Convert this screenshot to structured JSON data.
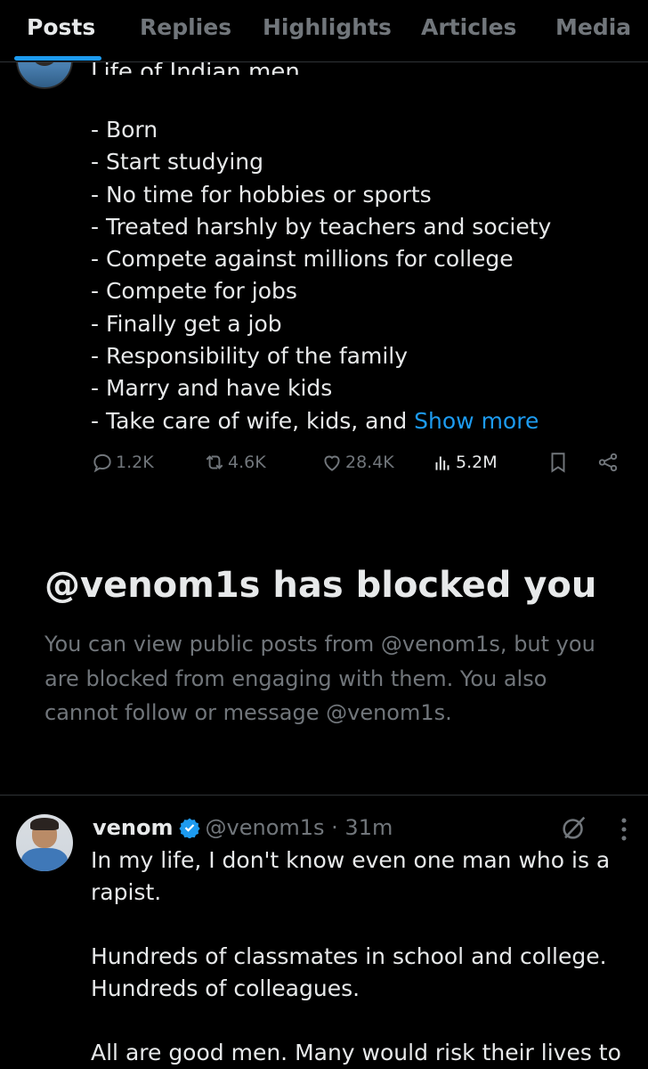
{
  "tabs": [
    {
      "label": "Posts",
      "active": true
    },
    {
      "label": "Replies",
      "active": false
    },
    {
      "label": "Highlights",
      "active": false
    },
    {
      "label": "Articles",
      "active": false
    },
    {
      "label": "Media",
      "active": false
    }
  ],
  "post1": {
    "clipped_title": "Life of Indian men",
    "lines": [
      "- Born",
      "- Start studying",
      "- No time for hobbies or sports",
      "- Treated harshly by teachers and society",
      "- Compete against millions for college",
      "- Compete for jobs",
      "- Finally get a job",
      "- Responsibility of the family",
      "- Marry and have kids"
    ],
    "last_line": "- Take care of wife, kids, and ",
    "show_more": "Show more",
    "replies": "1.2K",
    "reposts": "4.6K",
    "likes": "28.4K",
    "views": "5.2M"
  },
  "blocked": {
    "title": "@venom1s has blocked you",
    "body": "You can view public posts from @venom1s, but you are blocked from engaging with them. You also cannot follow or message @venom1s."
  },
  "post2": {
    "name": "venom",
    "handle_time": "@venom1s · 31m",
    "paragraphs": [
      [
        "In my life, I don't know even one man who is a",
        "rapist."
      ],
      [
        "Hundreds of classmates in school and college.",
        "Hundreds of colleagues."
      ],
      [
        "All are good men. Many would risk their lives to"
      ]
    ]
  },
  "colors": {
    "background": "#000000",
    "text": "#e7e9ea",
    "muted": "#71767b",
    "accent": "#1d9bf0"
  },
  "icons": [
    "reply-icon",
    "repost-icon",
    "like-icon",
    "views-icon",
    "bookmark-icon",
    "share-icon",
    "verified-badge-icon",
    "grok-icon",
    "more-icon"
  ]
}
